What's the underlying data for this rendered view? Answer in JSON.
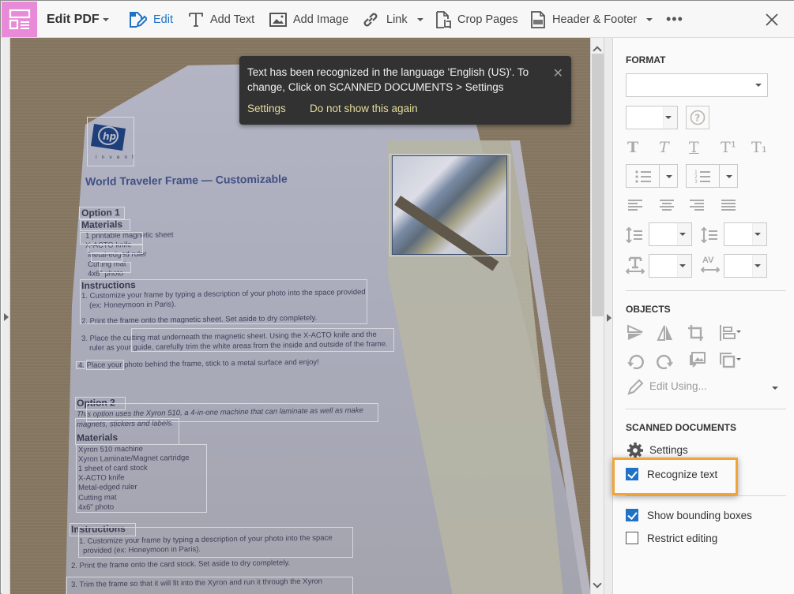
{
  "toolbar": {
    "mode_label": "Edit PDF",
    "items": [
      {
        "label": "Edit",
        "icon": "edit-icon",
        "active": true
      },
      {
        "label": "Add Text",
        "icon": "text-icon"
      },
      {
        "label": "Add Image",
        "icon": "image-icon"
      },
      {
        "label": "Link",
        "icon": "link-icon",
        "has_dropdown": true
      },
      {
        "label": "Crop Pages",
        "icon": "crop-pages-icon"
      },
      {
        "label": "Header & Footer",
        "icon": "header-footer-icon",
        "has_dropdown": true
      }
    ],
    "more_label": "•••",
    "close_icon": "close-icon",
    "accent_color": "#e98ad9",
    "active_color": "#1f72c6"
  },
  "toast": {
    "message": "Text has been recognized in the language 'English (US)'. To change, Click on SCANNED DOCUMENTS > Settings",
    "settings_link": "Settings",
    "dont_show_link": "Do not show this again",
    "close_glyph": "✕"
  },
  "document": {
    "title": "World Traveler Frame — Customizable",
    "option1": {
      "heading": "Option 1",
      "materials_heading": "Materials",
      "materials": [
        "1 printable magnetic sheet",
        "X-ACTO knife",
        "Metal-edged ruler",
        "Cutting mat",
        "4x6\" photo"
      ],
      "instructions_heading": "Instructions",
      "instructions": [
        "1. Customize your frame by typing a description of your photo into the space provided",
        "(ex: Honeymoon in Paris).",
        "2. Print the frame onto the magnetic sheet. Set aside to dry completely.",
        "3. Place the cutting mat underneath the magnetic sheet. Using the X-ACTO knife and the",
        "ruler as your guide, carefully trim the white areas from the inside and outside of the frame.",
        "4. Place your photo behind the frame, stick to a metal surface and enjoy!"
      ]
    },
    "option2": {
      "heading": "Option 2",
      "intro": [
        "This option uses the Xyron 510, a 4-in-one machine that can laminate as well as make",
        "magnets, stickers and labels."
      ],
      "materials_heading": "Materials",
      "materials": [
        "Xyron 510 machine",
        "Xyron Laminate/Magnet cartridge",
        "1 sheet of card stock",
        "X-ACTO knife",
        "Metal-edged ruler",
        "Cutting mat",
        "4x6\" photo"
      ],
      "instructions_heading": "Instructions",
      "instructions": [
        "1. Customize your frame by typing a description of your photo into the space",
        "provided (ex: Honeymoon in Paris).",
        "2. Print the frame onto the card stock. Set aside to dry completely.",
        "3. Trim the frame so that it will fit into the Xyron and run it through the Xyron"
      ]
    },
    "logo_text": "hp",
    "logo_sub": "invent"
  },
  "panel": {
    "format_title": "FORMAT",
    "font_value": "",
    "size_value": "",
    "text_styles": [
      "T",
      "T",
      "T",
      "T¹",
      "T₁"
    ],
    "line_spacing_value": "",
    "para_spacing_value": "",
    "scale_value": "",
    "char_spacing_value": "",
    "char_spacing_label": "AV",
    "objects_title": "OBJECTS",
    "edit_using_label": "Edit Using...",
    "scanned_title": "SCANNED DOCUMENTS",
    "settings_label": "Settings",
    "recognize_text_label": "Recognize text",
    "recognize_text_checked": true,
    "show_bbox_label": "Show bounding boxes",
    "show_bbox_checked": true,
    "restrict_label": "Restrict editing",
    "restrict_checked": false,
    "highlight_color": "#f0a43a"
  }
}
